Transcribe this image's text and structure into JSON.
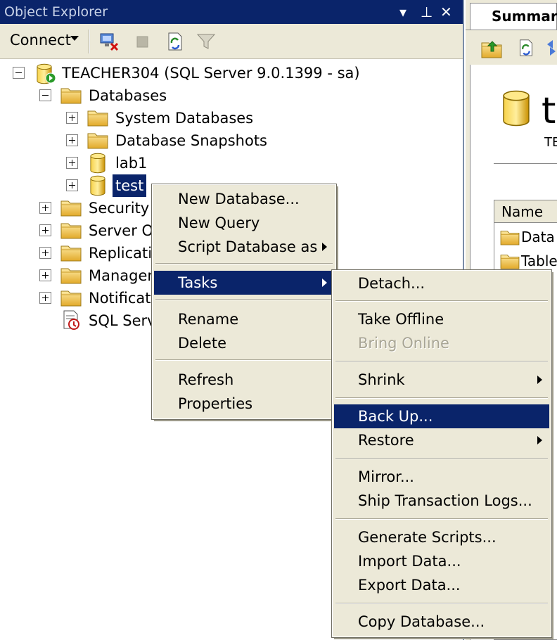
{
  "object_explorer": {
    "title": "Object Explorer",
    "controls": {
      "dropdown": "▾",
      "pin": "⊥",
      "close": "✕"
    },
    "toolbar": {
      "connect_label": "Connect"
    },
    "tree": {
      "server": "TEACHER304 (SQL Server 9.0.1399 - sa)",
      "databases": "Databases",
      "system_databases": "System Databases",
      "database_snapshots": "Database Snapshots",
      "db_lab1": "lab1",
      "db_test": "test",
      "security": "Security",
      "server_objects": "Server O",
      "replication": "Replicatio",
      "management": "Managem",
      "notification": "Notificatio",
      "sql_server_agent": "SQL Serv"
    }
  },
  "summary_pane": {
    "tab_label": "Summar",
    "big_text": "te",
    "sub_text": "TE",
    "grid_header": "Name",
    "rows": [
      "Data",
      "Table"
    ]
  },
  "context_menu": {
    "new_database": "New Database...",
    "new_query": "New Query",
    "script_database_as": "Script Database as",
    "tasks": "Tasks",
    "rename": "Rename",
    "delete": "Delete",
    "refresh": "Refresh",
    "properties": "Properties"
  },
  "tasks_menu": {
    "detach": "Detach...",
    "take_offline": "Take Offline",
    "bring_online": "Bring Online",
    "shrink": "Shrink",
    "back_up": "Back Up...",
    "restore": "Restore",
    "mirror": "Mirror...",
    "ship_transaction_logs": "Ship Transaction Logs...",
    "generate_scripts": "Generate Scripts...",
    "import_data": "Import Data...",
    "export_data": "Export Data...",
    "copy_database": "Copy Database..."
  },
  "colors": {
    "title_bar": "#0a246a",
    "menu_bg": "#ece9d8",
    "highlight": "#0a246a",
    "folder": "#f0c850",
    "db_cylinder": "#e8b800"
  }
}
